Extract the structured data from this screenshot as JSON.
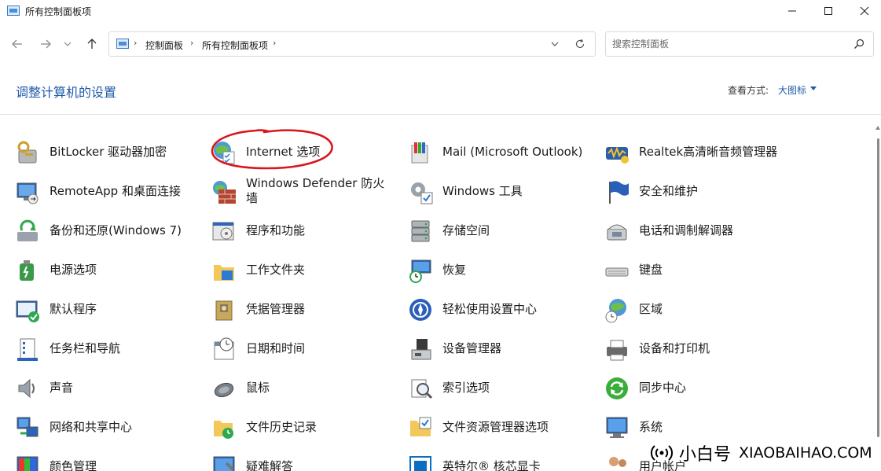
{
  "window": {
    "title": "所有控制面板项"
  },
  "nav": {
    "breadcrumb": [
      "控制面板",
      "所有控制面板项"
    ],
    "search_placeholder": "搜索控制面板"
  },
  "header": {
    "title": "调整计算机的设置",
    "viewby_label": "查看方式:",
    "viewby_value": "大图标"
  },
  "items": [
    {
      "label": "BitLocker 驱动器加密",
      "icon": "bitlocker-icon"
    },
    {
      "label": "Internet 选项",
      "icon": "internet-options-icon"
    },
    {
      "label": "Mail (Microsoft Outlook)",
      "icon": "mail-icon"
    },
    {
      "label": "Realtek高清晰音频管理器",
      "icon": "realtek-audio-icon"
    },
    {
      "label": "RemoteApp 和桌面连接",
      "icon": "remoteapp-icon"
    },
    {
      "label": "Windows Defender 防火墙",
      "icon": "firewall-icon"
    },
    {
      "label": "Windows 工具",
      "icon": "windows-tools-icon"
    },
    {
      "label": "安全和维护",
      "icon": "security-flag-icon"
    },
    {
      "label": "备份和还原(Windows 7)",
      "icon": "backup-icon"
    },
    {
      "label": "程序和功能",
      "icon": "programs-icon"
    },
    {
      "label": "存储空间",
      "icon": "storage-icon"
    },
    {
      "label": "电话和调制解调器",
      "icon": "phone-modem-icon"
    },
    {
      "label": "电源选项",
      "icon": "power-icon"
    },
    {
      "label": "工作文件夹",
      "icon": "work-folders-icon"
    },
    {
      "label": "恢复",
      "icon": "recovery-icon"
    },
    {
      "label": "键盘",
      "icon": "keyboard-icon"
    },
    {
      "label": "默认程序",
      "icon": "default-programs-icon"
    },
    {
      "label": "凭据管理器",
      "icon": "credential-manager-icon"
    },
    {
      "label": "轻松使用设置中心",
      "icon": "ease-of-access-icon"
    },
    {
      "label": "区域",
      "icon": "region-icon"
    },
    {
      "label": "任务栏和导航",
      "icon": "taskbar-icon"
    },
    {
      "label": "日期和时间",
      "icon": "date-time-icon"
    },
    {
      "label": "设备管理器",
      "icon": "device-manager-icon"
    },
    {
      "label": "设备和打印机",
      "icon": "printer-icon"
    },
    {
      "label": "声音",
      "icon": "sound-icon"
    },
    {
      "label": "鼠标",
      "icon": "mouse-icon"
    },
    {
      "label": "索引选项",
      "icon": "indexing-icon"
    },
    {
      "label": "同步中心",
      "icon": "sync-center-icon"
    },
    {
      "label": "网络和共享中心",
      "icon": "network-icon"
    },
    {
      "label": "文件历史记录",
      "icon": "file-history-icon"
    },
    {
      "label": "文件资源管理器选项",
      "icon": "explorer-options-icon"
    },
    {
      "label": "系统",
      "icon": "system-icon"
    },
    {
      "label": "颜色管理",
      "icon": "color-management-icon"
    },
    {
      "label": "疑难解答",
      "icon": "troubleshooting-icon"
    },
    {
      "label": "英特尔® 核芯显卡",
      "icon": "intel-graphics-icon"
    },
    {
      "label": "用户帐户",
      "icon": "user-accounts-icon"
    }
  ],
  "badge": {
    "name": "小白号",
    "site": "XIAOBAIHAO.COM"
  },
  "colors": {
    "accent": "#1e5aa8",
    "annotation": "#d9161c"
  }
}
